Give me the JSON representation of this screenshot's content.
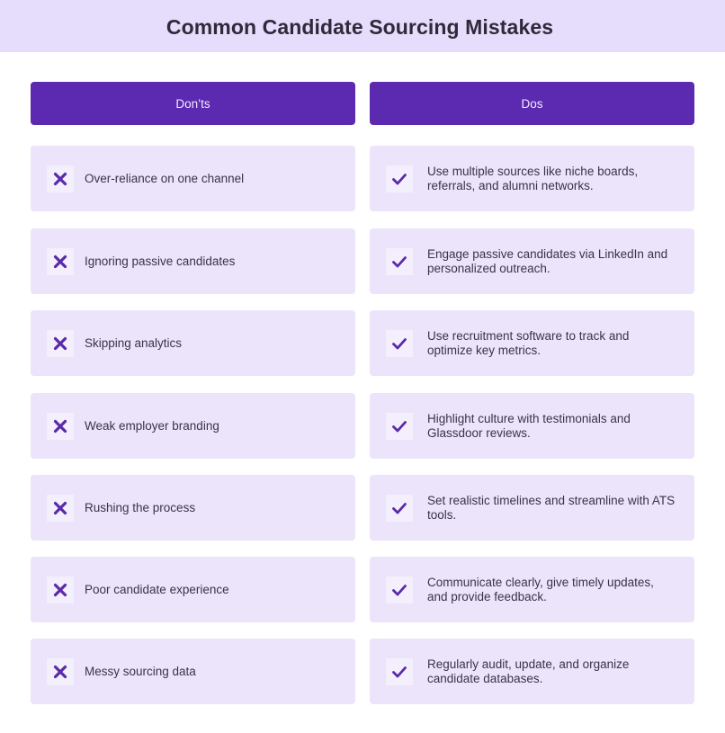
{
  "header": {
    "title": "Common Candidate Sourcing Mistakes"
  },
  "columns": {
    "donts_label": "Don’ts",
    "dos_label": "Dos"
  },
  "icons": {
    "dont_icon": "x-mark-icon",
    "do_icon": "check-mark-icon"
  },
  "colors": {
    "header_band": "#e6dcfb",
    "column_header": "#5c29b1",
    "card_background": "#ebe4fa",
    "icon_color": "#5a2aa8"
  },
  "rows": [
    {
      "dont": "Over-reliance on one channel",
      "do": "Use multiple sources like niche boards, referrals, and alumni networks."
    },
    {
      "dont": "Ignoring passive candidates",
      "do": "Engage passive candidates via LinkedIn and personalized outreach."
    },
    {
      "dont": "Skipping analytics",
      "do": "Use recruitment software to track and optimize key metrics."
    },
    {
      "dont": "Weak employer branding",
      "do": "Highlight culture with testimonials and Glassdoor reviews."
    },
    {
      "dont": "Rushing the process",
      "do": "Set realistic timelines and streamline with ATS tools."
    },
    {
      "dont": "Poor candidate experience",
      "do": "Communicate clearly, give timely updates, and provide feedback."
    },
    {
      "dont": "Messy sourcing data",
      "do": "Regularly audit, update, and organize candidate databases."
    }
  ]
}
